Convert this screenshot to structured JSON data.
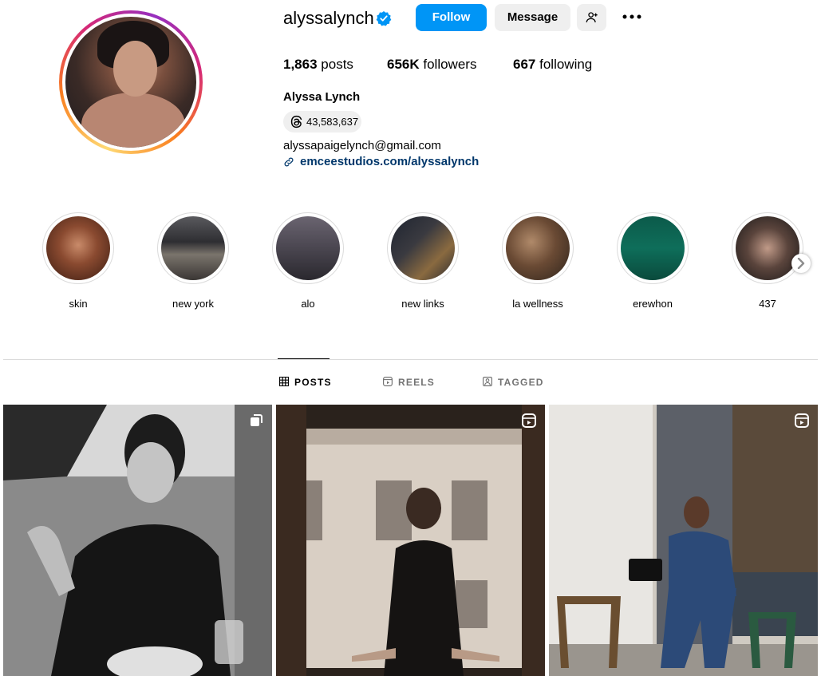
{
  "profile": {
    "username": "alyssalynch",
    "verified": true,
    "follow_label": "Follow",
    "message_label": "Message",
    "add_user_icon": "person-add-icon",
    "more_icon": "more-options-icon",
    "stats": {
      "posts_count": "1,863",
      "posts_label": "posts",
      "followers_count": "656K",
      "followers_label": "followers",
      "following_count": "667",
      "following_label": "following"
    },
    "full_name": "Alyssa Lynch",
    "threads_count": "43,583,637",
    "email": "alyssapaigelynch@gmail.com",
    "website": "emceestudios.com/alyssalynch"
  },
  "highlights": [
    {
      "label": "skin"
    },
    {
      "label": "new york"
    },
    {
      "label": "alo"
    },
    {
      "label": "new links"
    },
    {
      "label": "la wellness"
    },
    {
      "label": "erewhon"
    },
    {
      "label": "437"
    }
  ],
  "tabs": [
    {
      "label": "POSTS",
      "icon": "grid-icon",
      "active": true
    },
    {
      "label": "REELS",
      "icon": "reels-icon",
      "active": false
    },
    {
      "label": "TAGGED",
      "icon": "tagged-icon",
      "active": false
    }
  ],
  "posts": [
    {
      "type": "carousel",
      "icon": "carousel-icon"
    },
    {
      "type": "reel",
      "icon": "reel-icon"
    },
    {
      "type": "reel",
      "icon": "reel-icon"
    }
  ],
  "colors": {
    "follow_button": "#0095f6",
    "secondary_button": "#efefef",
    "link": "#00376b",
    "verified_badge": "#0095f6"
  }
}
